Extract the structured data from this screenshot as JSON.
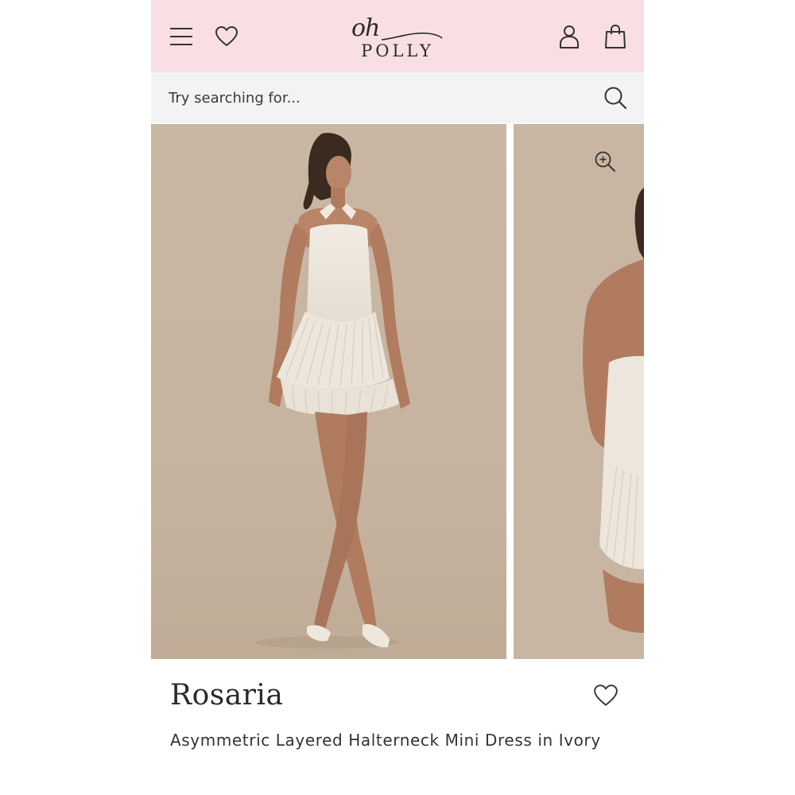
{
  "header": {
    "logo_script": "oh",
    "logo_wordmark": "POLLY",
    "icons": [
      "menu-icon",
      "heart-icon",
      "account-icon",
      "bag-icon"
    ],
    "background": "#f9dfe3"
  },
  "search": {
    "placeholder": "Try searching for...",
    "value": "",
    "icon": "search-icon"
  },
  "gallery": {
    "zoom_icon": "zoom-in-icon",
    "backdrop": "#c8b6a2"
  },
  "product": {
    "name": "Rosaria",
    "description": "Asymmetric Layered Halterneck Mini Dress in Ivory",
    "wishlist_icon": "heart-icon"
  }
}
